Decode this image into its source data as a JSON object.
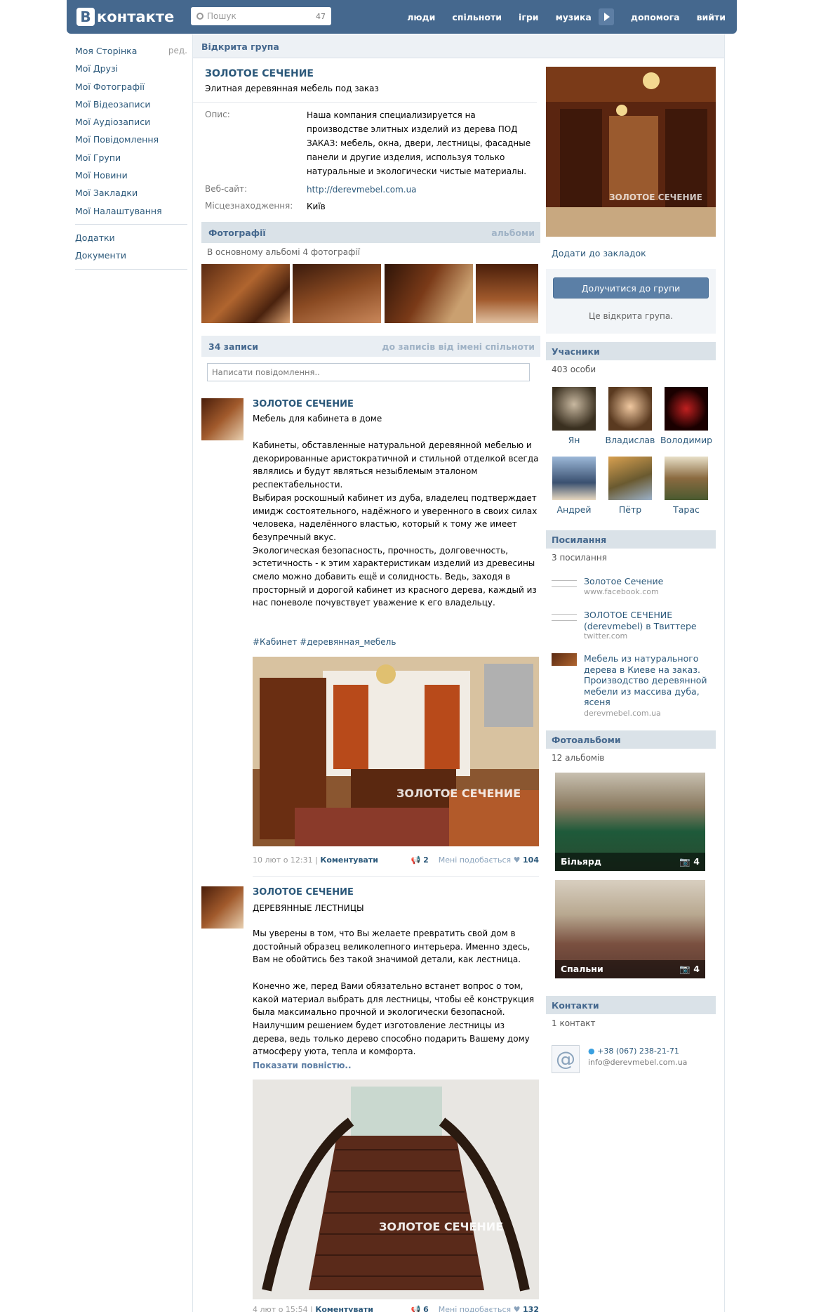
{
  "header": {
    "logo_letter": "В",
    "logo_text": "контакте",
    "search_placeholder": "Пошук",
    "search_count": "47",
    "nav": [
      "люди",
      "спільноти",
      "ігри",
      "музика",
      "допомога",
      "вийти"
    ]
  },
  "left_menu": {
    "items": [
      "Моя Сторінка",
      "Мої Друзі",
      "Мої Фотографії",
      "Мої Відеозаписи",
      "Мої Аудіозаписи",
      "Мої Повідомлення",
      "Мої Групи",
      "Мої Новини",
      "Мої Закладки",
      "Мої Налаштування"
    ],
    "edit_label": "ред.",
    "extra": [
      "Додатки",
      "Документи"
    ]
  },
  "group": {
    "type_label": "Відкрита група",
    "name": "ЗОЛОТОЕ СЕЧЕНИЕ",
    "status": "Элитная деревянная мебель под заказ",
    "info": {
      "desc_label": "Опис:",
      "desc": "Наша компания специализируется на производстве элитных изделий из дерева ПОД ЗАКАЗ: мебель, окна, двери, лестницы, фасадные панели и другие изделия, используя только натуральные и экологически чистые материалы.",
      "site_label": "Веб-сайт:",
      "site": "http://derevmebel.com.ua",
      "loc_label": "Місцезнаходження:",
      "loc": "Київ"
    }
  },
  "photos": {
    "title": "Фотографії",
    "link": "альбоми",
    "subtitle": "В основному альбомі 4 фотографії"
  },
  "wall": {
    "title": "34 записи",
    "link": "до записів від імені спільноти",
    "composer_placeholder": "Написати повідомлення.."
  },
  "posts": [
    {
      "author": "ЗОЛОТОЕ СЕЧЕНИЕ",
      "subtitle": "Мебель для кабинета в доме",
      "body": "Кабинеты, обставленные натуральной деревянной мебелью и декорированные аристократичной и стильной отделкой всегда являлись и будут являться незыблемым эталоном респектабельности.\nВыбирая роскошный кабинет из дуба, владелец подтверждает имидж состоятельного, надёжного и уверенного в своих силах человека, наделённого властью, который к тому же имеет безупречный вкус.\nЭкологическая безопасность, прочность, долговечность, эстетичность - к этим характеристикам изделий из древесины смело можно добавить ещё и солидность. Ведь, заходя в просторный и дорогой кабинет из красного дерева, каждый из нас поневоле почувствует уважение к его владельцу.",
      "hashtags": "#Кабинет #деревянная_мебель",
      "watermark": "ЗОЛОТОЕ СЕЧЕНИЕ",
      "date": "10 лют о 12:31",
      "comment": "Коментувати",
      "reposts": "2",
      "like_label": "Мені подобається",
      "likes": "104"
    },
    {
      "author": "ЗОЛОТОЕ СЕЧЕНИЕ",
      "subtitle": "ДЕРЕВЯННЫЕ ЛЕСТНИЦЫ",
      "body": "Мы уверены в том, что Вы желаете превратить свой дом в достойный образец великолепного интерьера. Именно здесь, Вам не обойтись без такой значимой детали, как лестница.\n\nКонечно же, перед Вами обязательно встанет вопрос о том, какой материал выбрать для лестницы, чтобы её конструкция была максимально прочной и экологически безопасной. Наилучшим решением будет изготовление лестницы из дерева, ведь только дерево способно подарить Вашему дому атмосферу уюта, тепла и комфорта.",
      "show_more": "Показати повністю..",
      "watermark": "ЗОЛОТОЕ СЕЧЕНИЕ",
      "date": "4 лют о 15:54",
      "comment": "Коментувати",
      "reposts": "6",
      "like_label": "Мені подобається",
      "likes": "132"
    }
  ],
  "right": {
    "cover_watermark": "ЗОЛОТОЕ СЕЧЕНИЕ",
    "bookmark": "Додати до закладок",
    "join_button": "Долучитися до групи",
    "join_note": "Це відкрита група.",
    "members_title": "Учасники",
    "members_count": "403 особи",
    "members": [
      "Ян",
      "Владислав",
      "Володимир",
      "Андрей",
      "Пётр",
      "Тарас"
    ],
    "links_title": "Посилання",
    "links_count": "3 посилання",
    "links": [
      {
        "title": "Золотое Сечение",
        "domain": "www.facebook.com"
      },
      {
        "title": "ЗОЛОТОЕ СЕЧЕНИЕ (derevmebel) в Твиттере",
        "domain": "twitter.com"
      },
      {
        "title": "Мебель из натурального дерева в Киеве на заказ. Производство деревянной мебели из массива дуба, ясеня",
        "domain": "derevmebel.com.ua"
      }
    ],
    "albums_title": "Фотоальбоми",
    "albums_count": "12 альбомів",
    "albums": [
      {
        "name": "Більярд",
        "count": "4"
      },
      {
        "name": "Спальни",
        "count": "4"
      }
    ],
    "contacts_title": "Контакти",
    "contacts_count": "1 контакт",
    "contact_phone": "+38 (067) 238-21-71",
    "contact_email": "info@derevmebel.com.ua"
  }
}
